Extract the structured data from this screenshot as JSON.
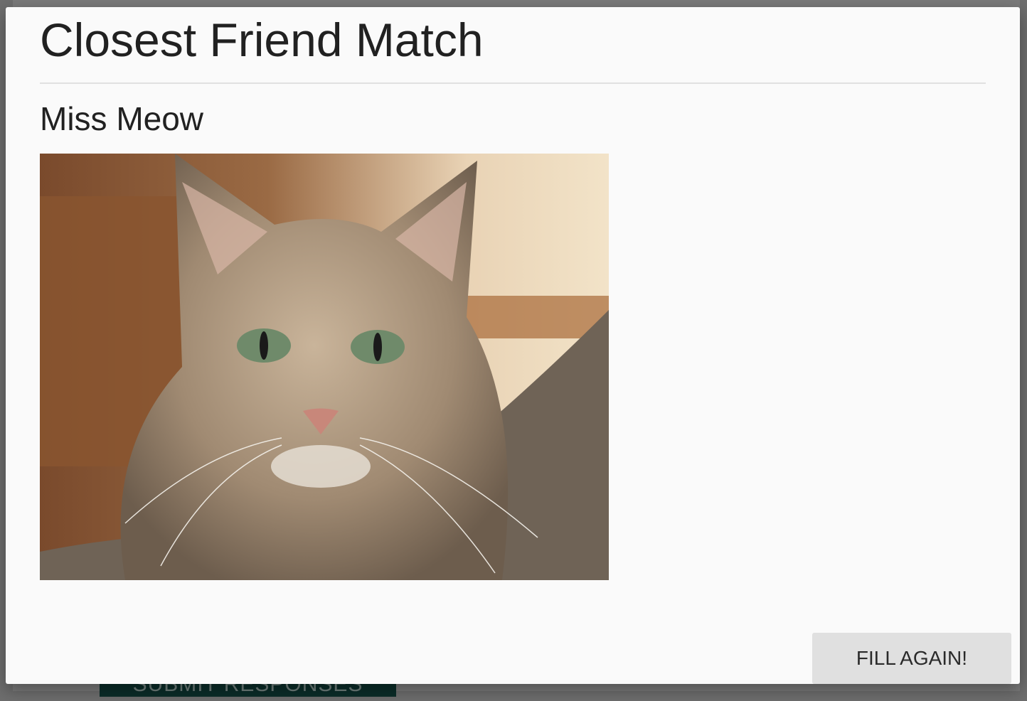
{
  "background": {
    "submit_label": "SUBMIT RESPONSES"
  },
  "modal": {
    "title": "Closest Friend Match",
    "match_name": "Miss Meow",
    "photo_alt": "Miss Meow",
    "fill_again_label": "FILL AGAIN!"
  }
}
